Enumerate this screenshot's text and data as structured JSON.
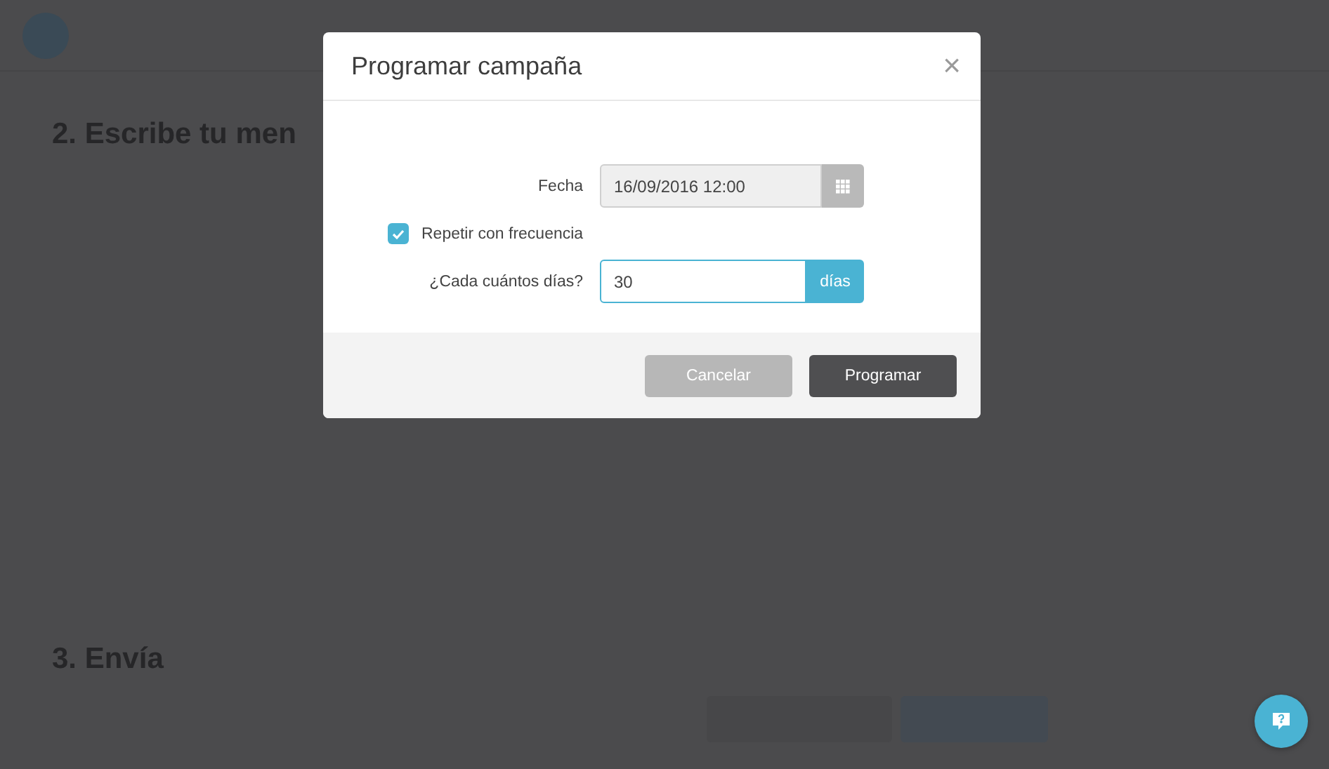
{
  "background": {
    "sections": [
      {
        "heading": "2. Escribe tu men"
      },
      {
        "heading": "3. Envía"
      }
    ]
  },
  "dialog": {
    "title": "Programar campaña",
    "close": "×",
    "fields": [
      {
        "kind": "date",
        "label": "Fecha",
        "value": "16/09/2016 12:00",
        "disabled": true
      },
      {
        "kind": "checkbox",
        "label": "Repetir con frecuencia",
        "checked": true
      },
      {
        "kind": "addon",
        "label": "¿Cada cuántos días?",
        "value": "30",
        "addon": "días",
        "focused": true
      }
    ],
    "buttons": [
      {
        "label": "Cancelar",
        "kind": "secondary"
      },
      {
        "label": "Programar",
        "kind": "primary"
      }
    ]
  }
}
